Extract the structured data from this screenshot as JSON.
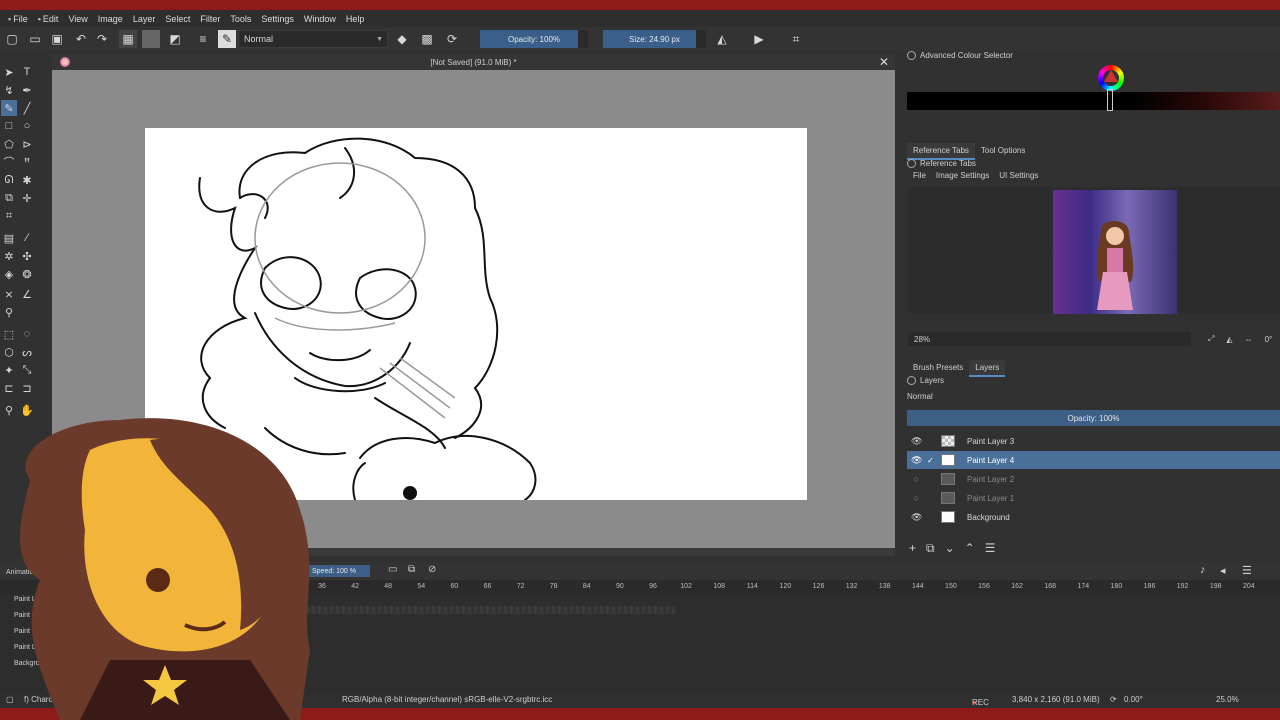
{
  "menu": [
    "File",
    "Edit",
    "View",
    "Image",
    "Layer",
    "Select",
    "Filter",
    "Tools",
    "Settings",
    "Window",
    "Help"
  ],
  "toolbar": {
    "blend_mode": "Normal",
    "opacity": "Opacity: 100%",
    "size": "Size: 24.90 px"
  },
  "document": {
    "title": "[Not Saved]  (91.0 MiB) *"
  },
  "docker": {
    "colour_selector_title": "Advanced Colour Selector",
    "tabs_top": [
      "Reference Tabs",
      "Tool Options"
    ],
    "reference_title": "Reference Tabs",
    "reference_menu": [
      "File",
      "Image Settings",
      "UI Settings"
    ],
    "zoom": "28%",
    "zoom_value_right": "0°",
    "tabs_bottom": [
      "Brush Presets",
      "Layers"
    ],
    "layers_title": "Layers",
    "layers_mode": "Normal",
    "layers_opacity": "Opacity:  100%",
    "layers": [
      {
        "name": "Paint Layer 3",
        "visible": true,
        "selected": false
      },
      {
        "name": "Paint Layer 4",
        "visible": true,
        "selected": true
      },
      {
        "name": "Paint Layer 2",
        "visible": false,
        "selected": false
      },
      {
        "name": "Paint Layer 1",
        "visible": false,
        "selected": false
      },
      {
        "name": "Background",
        "visible": true,
        "selected": false
      }
    ]
  },
  "timeline": {
    "panel_label": "Animation",
    "speed": "Speed:  100 %",
    "ruler": [
      "36",
      "42",
      "48",
      "54",
      "60",
      "66",
      "72",
      "78",
      "84",
      "90",
      "96",
      "102",
      "108",
      "114",
      "120",
      "126",
      "132",
      "138",
      "144",
      "150",
      "156",
      "162",
      "168",
      "174",
      "180",
      "186",
      "192",
      "198",
      "204"
    ],
    "left_layers": [
      "Paint Lay",
      "Paint Lay",
      "Paint Layer",
      "Paint Lay",
      "Backgroun"
    ]
  },
  "status": {
    "brush": "f) Charcoal Rock",
    "color_profile": "RGB/Alpha (8-bit integer/channel)  sRGB-elle-V2-srgbtrc.icc",
    "rec": "REC",
    "dimensions": "3,840 x 2,160 (91.0 MiB)",
    "rotation": "0.00°",
    "zoom": "25.0%"
  },
  "colors": {
    "accent": "#3d5f86",
    "selected_layer": "#4a6f99",
    "frame": "#8e1a1a"
  }
}
